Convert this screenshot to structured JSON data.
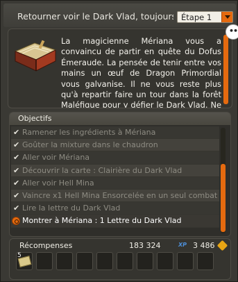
{
  "header": {
    "quest_title": "Retourner voir le Dark Vlad, toujours ...",
    "step_selected": "Étape 1"
  },
  "description": {
    "text": "La magicienne Mériana vous a convaincu de partir en quête du Dofus Émeraude. La pensée de tenir entre vos mains un œuf de Dragon Primordial vous galvanise. Il ne vous reste plus qu'à repartir faire un tour dans la forêt Maléfique pour y défier le Dark Vlad. Ne vous en faites pas, tout va bien se",
    "bubble": "•••"
  },
  "objectives": {
    "title": "Objectifs",
    "items": [
      {
        "label": "Ramener les ingrédients à Mériana",
        "status": "done"
      },
      {
        "label": "Goûter la mixture dans le chaudron",
        "status": "done"
      },
      {
        "label": "Aller voir Mériana",
        "status": "done"
      },
      {
        "label": "Découvrir la carte : Clairière du Dark Vlad",
        "status": "done"
      },
      {
        "label": "Aller voir Hell Mina",
        "status": "done"
      },
      {
        "label": "Vaincre x1 Hell Mina Ensorcelée en un seul combat",
        "status": "done"
      },
      {
        "label": "Lire la lettre du Dark Vlad",
        "status": "done"
      },
      {
        "label": "Montrer à Mériana : 1 Lettre du Dark Vlad",
        "status": "active"
      }
    ]
  },
  "rewards": {
    "title": "Récompenses",
    "xp": "183 324",
    "xp_unit": "XP",
    "kamas": "3 486",
    "item_count": "5",
    "slot_count": 10
  },
  "colors": {
    "accent": "#e56a0f",
    "panel": "#3a3934"
  }
}
